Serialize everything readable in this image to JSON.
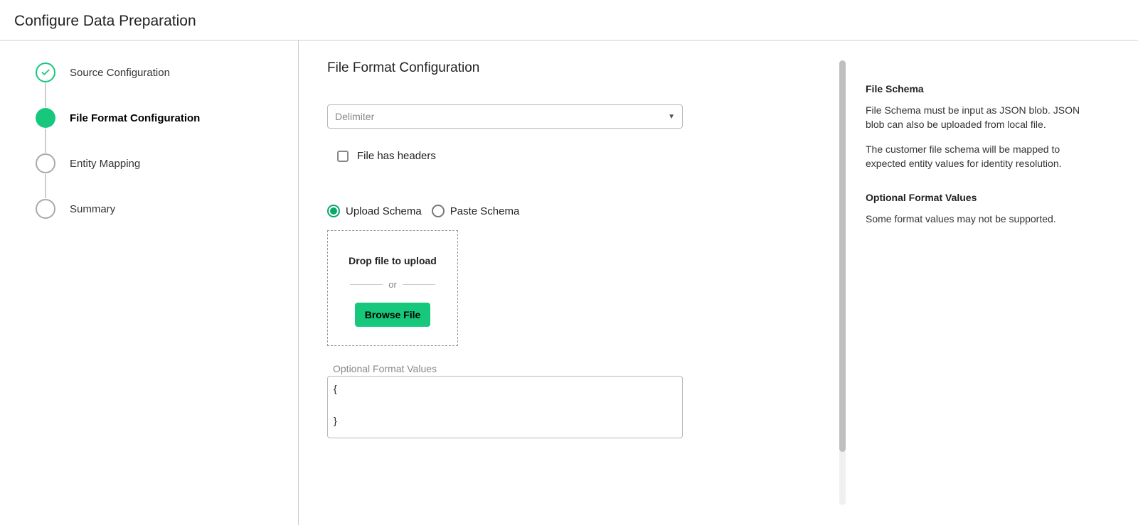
{
  "header": {
    "title": "Configure Data Preparation"
  },
  "steps": [
    {
      "label": "Source Configuration"
    },
    {
      "label": "File Format Configuration"
    },
    {
      "label": "Entity Mapping"
    },
    {
      "label": "Summary"
    }
  ],
  "form": {
    "title": "File Format Configuration",
    "delimiter_placeholder": "Delimiter",
    "file_has_headers_label": "File has headers",
    "upload_schema_label": "Upload Schema",
    "paste_schema_label": "Paste Schema",
    "dropzone_title": "Drop file to upload",
    "or_text": "or",
    "browse_label": "Browse File",
    "optional_label": "Optional Format Values",
    "optional_value": "{\n\n}"
  },
  "info": {
    "h1": "File Schema",
    "p1": "File Schema must be input as JSON blob. JSON blob can also be uploaded from local file.",
    "p2": "The customer file schema will be mapped to expected entity values for identity resolution.",
    "h2": "Optional Format Values",
    "p3": "Some format values may not be supported."
  }
}
